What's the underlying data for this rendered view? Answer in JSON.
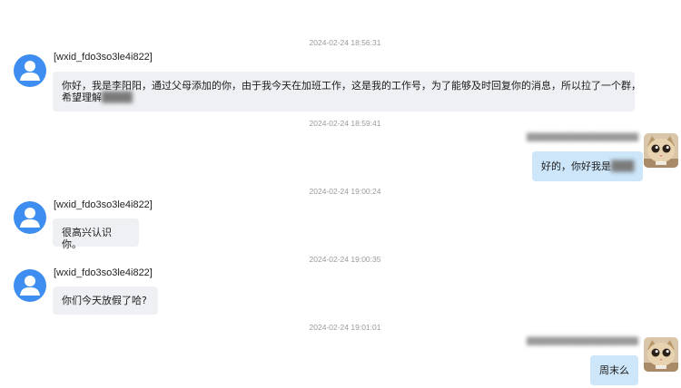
{
  "conversation": {
    "messages": [
      {
        "timestamp": "2024-02-24 18:56:31",
        "direction": "in",
        "sender": "[wxid_fdo3so3le4i822]",
        "line1": "你好，我是李阳阳，通过父母添加的你，由于我今天在加班工作，这是我的工作号，为了能够及时回复你的消息，所以拉了一个群，",
        "line2_prefix": "希望理解",
        "line2_blurred": "████"
      },
      {
        "timestamp": "2024-02-24 18:59:41",
        "direction": "out",
        "sender_blurred": "████████████████████",
        "text_prefix": "好的，你好我是",
        "text_blurred": "███"
      },
      {
        "timestamp": "2024-02-24 19:00:24",
        "direction": "in",
        "sender": "[wxid_fdo3so3le4i822]",
        "text": "很高兴认识你。"
      },
      {
        "timestamp": "2024-02-24 19:00:35",
        "direction": "in",
        "sender": "[wxid_fdo3so3le4i822]",
        "text": "你们今天放假了哈?"
      },
      {
        "timestamp": "2024-02-24 19:01:01",
        "direction": "out",
        "sender_blurred": "████████████████████",
        "text": "周末么"
      }
    ]
  },
  "icons": {
    "incoming_avatar": "default-user-icon",
    "outgoing_avatar": "cat-avatar"
  },
  "colors": {
    "incoming_bubble": "#eef0f4",
    "outgoing_bubble": "#cde6fa",
    "avatar_blue": "#3d8ef0",
    "timestamp": "#9a9a9a"
  }
}
